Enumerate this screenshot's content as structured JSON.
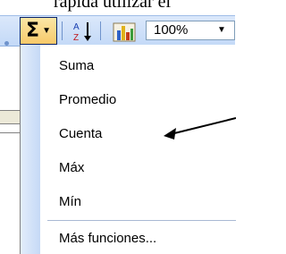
{
  "top_text": "rápida utilizar el",
  "toolbar": {
    "sigma_symbol": "Σ",
    "sigma_caret": "▼",
    "sort_icon": "sort-ascending-icon",
    "chart_icon": "chart-wizard-icon",
    "zoom_value": "100%",
    "zoom_caret": "▼"
  },
  "menu": {
    "items": [
      {
        "label": "Suma"
      },
      {
        "label": "Promedio"
      },
      {
        "label": "Cuenta"
      },
      {
        "label": "Máx"
      },
      {
        "label": "Mín"
      },
      {
        "label": "Más funciones..."
      }
    ]
  },
  "colors": {
    "toolbar": "#c3d9f7",
    "menu_strip": "#c5d9f6",
    "highlight": "#f7c96a"
  }
}
